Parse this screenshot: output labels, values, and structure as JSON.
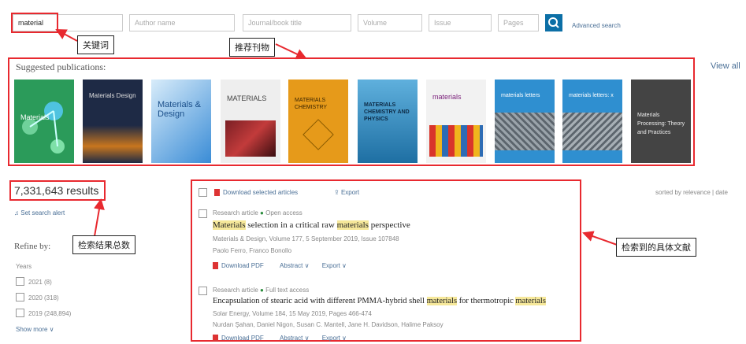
{
  "search": {
    "keyword_value": "material",
    "author_placeholder": "Author name",
    "journal_placeholder": "Journal/book title",
    "volume_placeholder": "Volume",
    "issue_placeholder": "Issue",
    "pages_placeholder": "Pages",
    "advanced_link": "Advanced search"
  },
  "annotations": {
    "keyword": "关键词",
    "suggested": "推荐刊物",
    "total": "检索结果总数",
    "articles": "检索到的具体文献"
  },
  "suggested": {
    "title": "Suggested publications:",
    "view_all": "View all",
    "covers": [
      {
        "title": "Materials",
        "color": "#2b9b5a"
      },
      {
        "title": "Materials Design",
        "color": "#1e2a45"
      },
      {
        "title": "Materials & Design",
        "color": "#3a8cd6"
      },
      {
        "title": "MATERIALS",
        "color": "#eeeeee"
      },
      {
        "title": "MATERIALS CHEMISTRY",
        "color": "#e69a1a"
      },
      {
        "title": "MATERIALS CHEMISTRY AND PHYSICS",
        "color": "#2b8fc2"
      },
      {
        "title": "materials",
        "color": "#f2f2f2"
      },
      {
        "title": "materials letters",
        "color": "#2f8fd0"
      },
      {
        "title": "materials letters: x",
        "color": "#2f8fd0"
      },
      {
        "title": "Materials Processing: Theory and Practices",
        "color": "#444444"
      }
    ]
  },
  "results": {
    "count": "7,331,643 results",
    "set_alert": "Set search alert",
    "sorted_by": "sorted by relevance | date"
  },
  "refine": {
    "title": "Refine by:",
    "years_label": "Years",
    "years": [
      "2021 (8)",
      "2020 (318)",
      "2019 (248,894)"
    ],
    "show_more": "Show more ∨"
  },
  "toolbar": {
    "download_selected": "Download selected articles",
    "export": "Export"
  },
  "articles": [
    {
      "type": "Research article",
      "access": "Open access",
      "title_pre": "",
      "title_hl1": "Materials",
      "title_mid": " selection in a critical raw ",
      "title_hl2": "materials",
      "title_post": " perspective",
      "source": "Materials & Design, Volume 177, 5 September 2019, Issue 107848",
      "authors": "Paolo Ferro, Franco Bonollo",
      "pdf": "Download PDF",
      "abstract": "Abstract ∨",
      "export": "Export ∨"
    },
    {
      "type": "Research article",
      "access": "Full text access",
      "title_pre": "Encapsulation of stearic acid with different PMMA-hybrid shell ",
      "title_hl1": "materials",
      "title_mid": " for thermotropic ",
      "title_hl2": "materials",
      "title_post": "",
      "source": "Solar Energy, Volume 184, 15 May 2019, Pages 466-474",
      "authors": "Nurdan Şahan, Daniel Nigon, Susan C. Mantell, Jane H. Davidson, Halime Paksoy",
      "pdf": "Download PDF",
      "abstract": "Abstract ∨",
      "export": "Export ∨"
    }
  ]
}
